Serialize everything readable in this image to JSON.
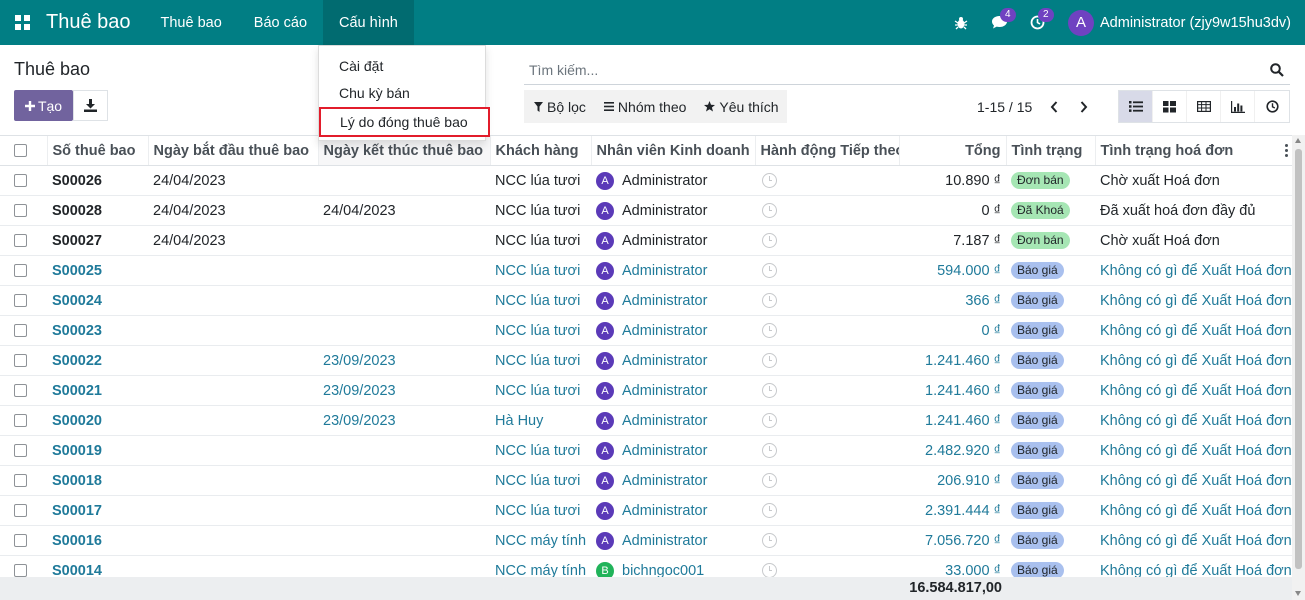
{
  "navbar": {
    "app_name": "Thuê bao",
    "menu": [
      {
        "label": "Thuê bao"
      },
      {
        "label": "Báo cáo"
      },
      {
        "label": "Cấu hình"
      }
    ],
    "messages_count": "4",
    "activities_count": "2",
    "user_initial": "A",
    "user_name": "Administrator (zjy9w15hu3dv)"
  },
  "control_panel": {
    "title": "Thuê bao",
    "create_label": "Tạo",
    "search_placeholder": "Tìm kiếm...",
    "filters_label": "Bộ lọc",
    "group_by_label": "Nhóm theo",
    "favorites_label": "Yêu thích",
    "pager": "1-15 / 15"
  },
  "dropdown": {
    "items": [
      {
        "label": "Cài đặt"
      },
      {
        "label": "Chu kỳ bán"
      },
      {
        "label": "Lý do đóng thuê bao"
      }
    ]
  },
  "table": {
    "headers": [
      "Số thuê bao",
      "Ngày bắt đầu thuê bao",
      "Ngày kết thúc thuê bao",
      "Khách hàng",
      "Nhân viên Kinh doanh",
      "Hành động Tiếp theo",
      "Tổng",
      "Tình trạng",
      "Tình trạng hoá đơn"
    ],
    "rows": [
      {
        "code": "S00026",
        "start": "24/04/2023",
        "end": "",
        "customer": "NCC lúa tươi",
        "avatar": "A",
        "salesperson": "Administrator",
        "total": "10.890 ₫",
        "status": "Đơn bán",
        "invoice": "Chờ xuất Hoá đơn"
      },
      {
        "code": "S00028",
        "start": "24/04/2023",
        "end": "24/04/2023",
        "customer": "NCC lúa tươi",
        "avatar": "A",
        "salesperson": "Administrator",
        "total": "0 ₫",
        "status": "Đã Khoá",
        "invoice": "Đã xuất hoá đơn đầy đủ"
      },
      {
        "code": "S00027",
        "start": "24/04/2023",
        "end": "",
        "customer": "NCC lúa tươi",
        "avatar": "A",
        "salesperson": "Administrator",
        "total": "7.187 ₫",
        "status": "Đơn bán",
        "invoice": "Chờ xuất Hoá đơn"
      },
      {
        "code": "S00025",
        "start": "",
        "end": "",
        "customer": "NCC lúa tươi",
        "avatar": "A",
        "salesperson": "Administrator",
        "total": "594.000 ₫",
        "status": "Báo giá",
        "invoice": "Không có gì để Xuất Hoá đơn"
      },
      {
        "code": "S00024",
        "start": "",
        "end": "",
        "customer": "NCC lúa tươi",
        "avatar": "A",
        "salesperson": "Administrator",
        "total": "366 ₫",
        "status": "Báo giá",
        "invoice": "Không có gì để Xuất Hoá đơn"
      },
      {
        "code": "S00023",
        "start": "",
        "end": "",
        "customer": "NCC lúa tươi",
        "avatar": "A",
        "salesperson": "Administrator",
        "total": "0 ₫",
        "status": "Báo giá",
        "invoice": "Không có gì để Xuất Hoá đơn"
      },
      {
        "code": "S00022",
        "start": "",
        "end": "23/09/2023",
        "customer": "NCC lúa tươi",
        "avatar": "A",
        "salesperson": "Administrator",
        "total": "1.241.460 ₫",
        "status": "Báo giá",
        "invoice": "Không có gì để Xuất Hoá đơn"
      },
      {
        "code": "S00021",
        "start": "",
        "end": "23/09/2023",
        "customer": "NCC lúa tươi",
        "avatar": "A",
        "salesperson": "Administrator",
        "total": "1.241.460 ₫",
        "status": "Báo giá",
        "invoice": "Không có gì để Xuất Hoá đơn"
      },
      {
        "code": "S00020",
        "start": "",
        "end": "23/09/2023",
        "customer": "Hà Huy",
        "avatar": "A",
        "salesperson": "Administrator",
        "total": "1.241.460 ₫",
        "status": "Báo giá",
        "invoice": "Không có gì để Xuất Hoá đơn"
      },
      {
        "code": "S00019",
        "start": "",
        "end": "",
        "customer": "NCC lúa tươi",
        "avatar": "A",
        "salesperson": "Administrator",
        "total": "2.482.920 ₫",
        "status": "Báo giá",
        "invoice": "Không có gì để Xuất Hoá đơn"
      },
      {
        "code": "S00018",
        "start": "",
        "end": "",
        "customer": "NCC lúa tươi",
        "avatar": "A",
        "salesperson": "Administrator",
        "total": "206.910 ₫",
        "status": "Báo giá",
        "invoice": "Không có gì để Xuất Hoá đơn"
      },
      {
        "code": "S00017",
        "start": "",
        "end": "",
        "customer": "NCC lúa tươi",
        "avatar": "A",
        "salesperson": "Administrator",
        "total": "2.391.444 ₫",
        "status": "Báo giá",
        "invoice": "Không có gì để Xuất Hoá đơn"
      },
      {
        "code": "S00016",
        "start": "",
        "end": "",
        "customer": "NCC máy tính",
        "avatar": "A",
        "salesperson": "Administrator",
        "total": "7.056.720 ₫",
        "status": "Báo giá",
        "invoice": "Không có gì để Xuất Hoá đơn"
      },
      {
        "code": "S00014",
        "start": "",
        "end": "",
        "customer": "NCC máy tính",
        "avatar": "B",
        "salesperson": "bichngoc001",
        "total": "33.000 ₫",
        "status": "Báo giá",
        "invoice": "Không có gì để Xuất Hoá đơn"
      }
    ],
    "grand_total": "16.584.817,00"
  },
  "colors": {
    "navbar": "#017e84",
    "primary_button": "#71639e",
    "dropdown_highlight_border": "#e21c2b",
    "status_green": "#a6e6b4",
    "status_blue": "#a9c0ee",
    "draft_text": "#1f7a9a"
  },
  "icons": {
    "apps": "apps-grid-icon",
    "bug": "bug-icon",
    "messages": "chat-icon",
    "activities": "clock-icon",
    "search": "search-icon",
    "download": "download-icon",
    "filter": "funnel-icon",
    "group": "bars-icon",
    "favorites": "star-icon"
  }
}
